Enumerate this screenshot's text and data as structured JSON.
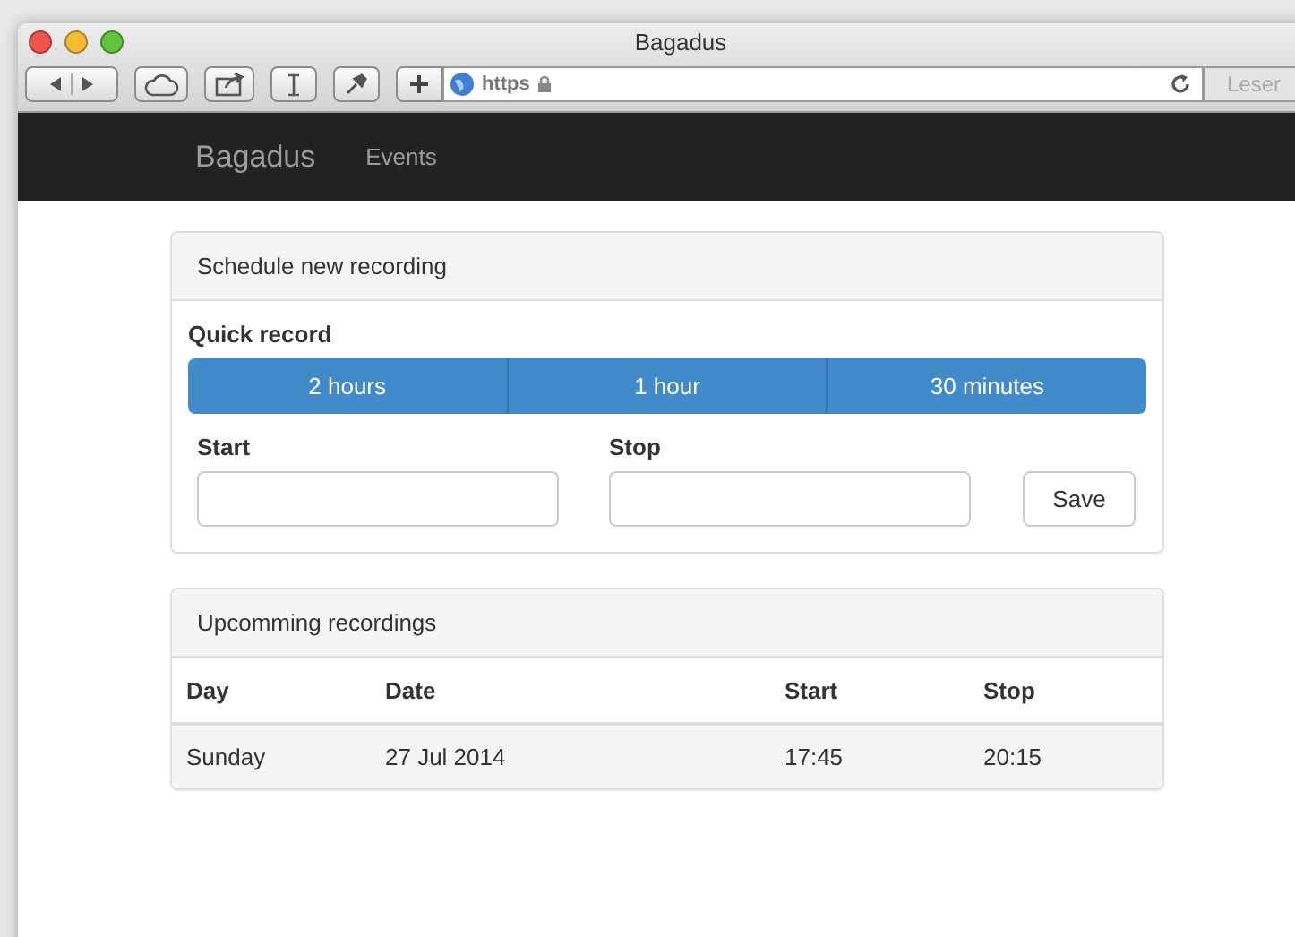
{
  "window": {
    "title": "Bagadus"
  },
  "address_bar": {
    "scheme": "https",
    "reader_button": "Leser"
  },
  "navbar": {
    "brand": "Bagadus",
    "links": [
      "Events"
    ]
  },
  "schedule_panel": {
    "title": "Schedule new recording",
    "quick_record_label": "Quick record",
    "quick_buttons": [
      "2 hours",
      "1 hour",
      "30 minutes"
    ],
    "fields": [
      {
        "label": "Start"
      },
      {
        "label": "Stop"
      }
    ],
    "save_button": "Save"
  },
  "recordings_panel": {
    "title": "Upcomming recordings",
    "table": {
      "columns": [
        "Day",
        "Date",
        "Start",
        "Stop"
      ],
      "rows": [
        [
          "Sunday",
          "27 Jul 2014",
          "17:45",
          "20:15"
        ]
      ]
    }
  }
}
